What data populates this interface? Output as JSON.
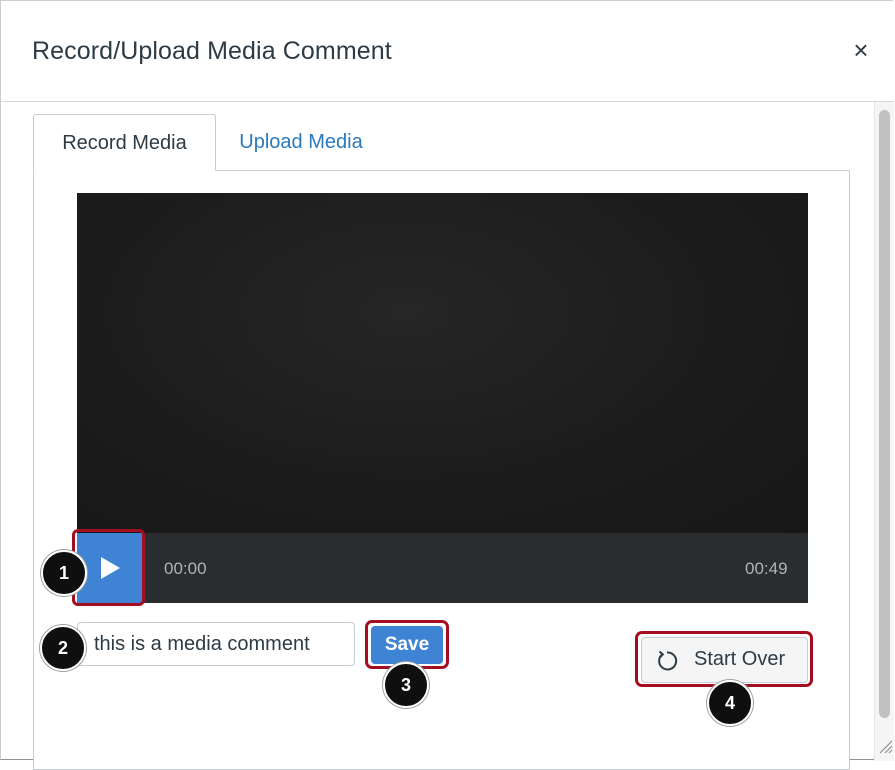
{
  "dialog": {
    "title": "Record/Upload Media Comment",
    "close_symbol": "×"
  },
  "tabs": [
    {
      "label": "Record Media",
      "active": true
    },
    {
      "label": "Upload Media",
      "active": false
    }
  ],
  "player": {
    "current_time": "00:00",
    "total_time": "00:49",
    "play_icon": "play-icon"
  },
  "comment": {
    "value": "this is a media comment"
  },
  "actions": {
    "save_label": "Save",
    "start_over_label": "Start Over",
    "start_over_icon": "refresh-icon"
  },
  "callouts": [
    "1",
    "2",
    "3",
    "4"
  ],
  "colors": {
    "accent": "#3f84d4",
    "highlight": "#a30f20",
    "link": "#2b7abc",
    "text": "#2d3b45"
  }
}
